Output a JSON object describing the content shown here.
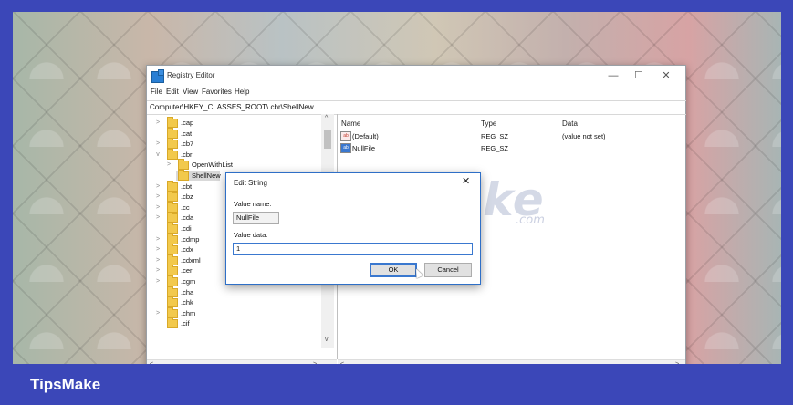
{
  "footer": {
    "brand": "TipsMake"
  },
  "window": {
    "title": "Registry Editor",
    "controls": {
      "minimize": "—",
      "maximize": "☐",
      "close": "✕"
    },
    "menu": [
      "File",
      "Edit",
      "View",
      "Favorites",
      "Help"
    ],
    "address": "Computer\\HKEY_CLASSES_ROOT\\.cbr\\ShellNew"
  },
  "tree": {
    "items": [
      {
        "label": ".cap",
        "expander": ">"
      },
      {
        "label": ".cat",
        "expander": ""
      },
      {
        "label": ".cb7",
        "expander": ">"
      },
      {
        "label": ".cbr",
        "expander": "v"
      },
      {
        "label": "OpenWithList",
        "expander": ">"
      },
      {
        "label": "ShellNew",
        "expander": ""
      },
      {
        "label": ".cbt",
        "expander": ">"
      },
      {
        "label": ".cbz",
        "expander": ">"
      },
      {
        "label": ".cc",
        "expander": ">"
      },
      {
        "label": ".cda",
        "expander": ">"
      },
      {
        "label": ".cdi",
        "expander": ""
      },
      {
        "label": ".cdmp",
        "expander": ">"
      },
      {
        "label": ".cdx",
        "expander": ">"
      },
      {
        "label": ".cdxml",
        "expander": ">"
      },
      {
        "label": ".cer",
        "expander": ">"
      },
      {
        "label": ".cgm",
        "expander": ">"
      },
      {
        "label": ".cha",
        "expander": ""
      },
      {
        "label": ".chk",
        "expander": ""
      },
      {
        "label": ".chm",
        "expander": ">"
      },
      {
        "label": ".cif",
        "expander": ""
      }
    ],
    "selected": "ShellNew"
  },
  "list": {
    "columns": [
      "Name",
      "Type",
      "Data"
    ],
    "rows": [
      {
        "icon": "string-value-icon",
        "name": "(Default)",
        "type": "REG_SZ",
        "data": "(value not set)"
      },
      {
        "icon": "string-value-icon",
        "name": "NullFile",
        "type": "REG_SZ",
        "data": ""
      }
    ]
  },
  "watermark": {
    "text": "TipsMake",
    "domain": ".com"
  },
  "dialog": {
    "title": "Edit String",
    "close": "✕",
    "value_name_label": "Value name:",
    "value_name": "NullFile",
    "value_data_label": "Value data:",
    "value_data": "1",
    "ok": "OK",
    "cancel": "Cancel"
  }
}
